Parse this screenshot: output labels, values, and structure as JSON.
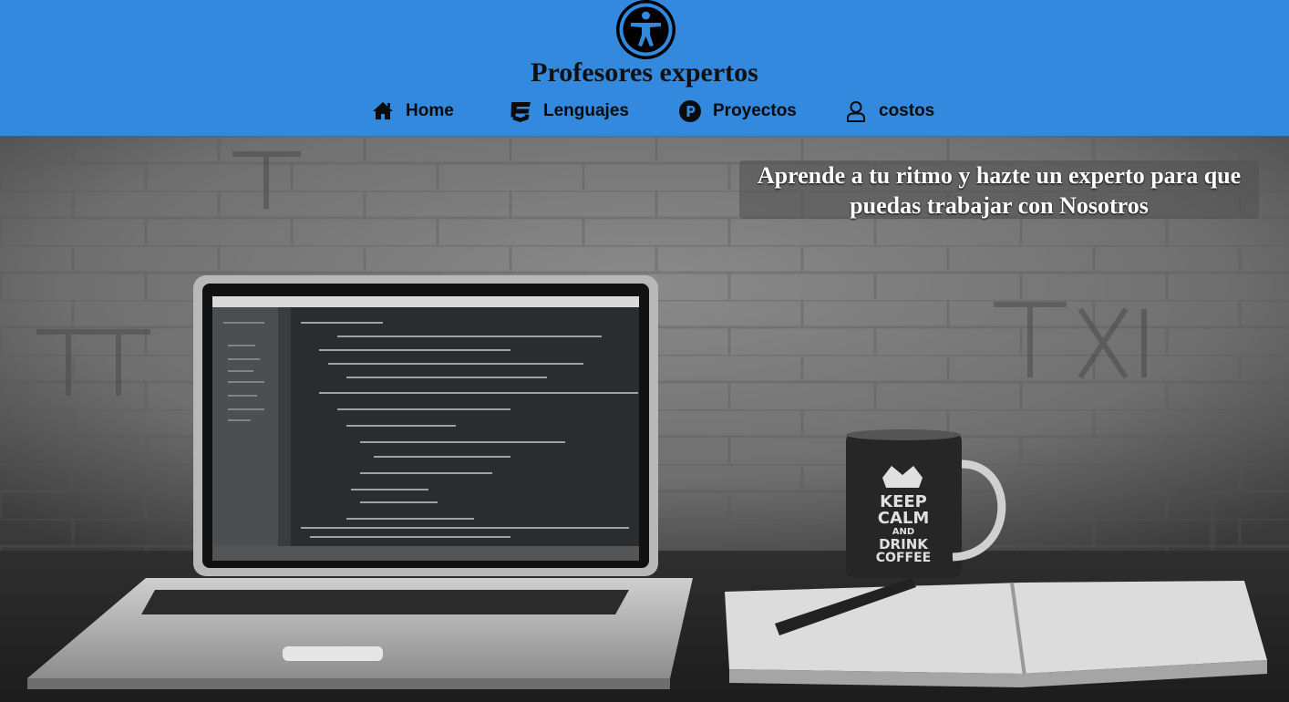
{
  "header": {
    "logo_icon": "accessibility-person-icon",
    "title": "Profesores expertos",
    "background_color": "#3289dd"
  },
  "nav": {
    "items": [
      {
        "label": "Home",
        "icon": "home-icon"
      },
      {
        "label": "Lenguajes",
        "icon": "css3-icon"
      },
      {
        "label": "Proyectos",
        "icon": "product-hunt-p-icon"
      },
      {
        "label": "costos",
        "icon": "user-outline-icon"
      }
    ]
  },
  "hero": {
    "headline": "Aprende a tu ritmo y hazte un experto para que puedas trabajar con Nosotros",
    "image_description_icon": "laptop-mug-notebook-photo",
    "mug_text": [
      "KEEP",
      "CALM",
      "AND",
      "DRINK",
      "COFFEE"
    ]
  }
}
